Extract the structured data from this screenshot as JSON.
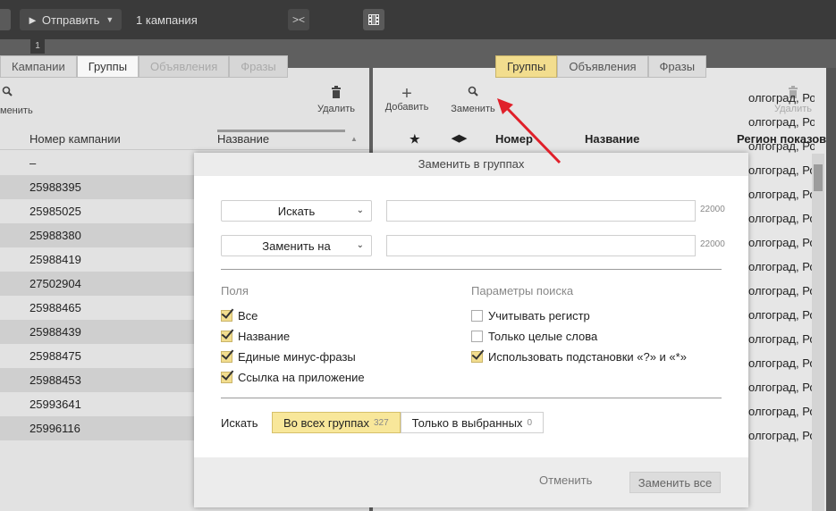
{
  "toolbar": {
    "send_label": "Отправить",
    "campaign_count": "1 кампания",
    "badge": "1",
    "collapse_glyph": "><"
  },
  "left": {
    "tabs": [
      {
        "label": "Кампании"
      },
      {
        "label": "Группы"
      },
      {
        "label": "Объявления"
      },
      {
        "label": "Фразы"
      }
    ],
    "replace_label": "менить",
    "delete_label": "Удалить",
    "columns": {
      "number": "Номер кампании",
      "name": "Название"
    },
    "rows": [
      "–",
      "25988395",
      "25985025",
      "25988380",
      "25988419",
      "27502904",
      "25988465",
      "25988439",
      "25988475",
      "25988453",
      "25993641",
      "25996116"
    ]
  },
  "right": {
    "tabs": [
      {
        "label": "Группы"
      },
      {
        "label": "Объявления"
      },
      {
        "label": "Фразы"
      }
    ],
    "add_label": "Добавить",
    "replace_label": "Заменить",
    "delete_label": "Удалить",
    "columns": {
      "star": "★",
      "number": "Номер",
      "name": "Название",
      "region": "Регион показов"
    },
    "region_rows": [
      "олгоград, Ро",
      "олгоград, Ро",
      "олгоград, Ро",
      "олгоград, Ро",
      "олгоград, Ро",
      "олгоград, Ро",
      "олгоград, Ро",
      "олгоград, Ро",
      "олгоград, Ро",
      "олгоград, Ро",
      "олгоград, Ро",
      "олгоград, Ро",
      "олгоград, Ро",
      "олгоград, Ро",
      "олгоград, Ро"
    ]
  },
  "modal": {
    "title": "Заменить в группах",
    "search_mode": "Искать",
    "replace_mode": "Заменить на",
    "search_value": "",
    "replace_value": "",
    "search_limit": "22000",
    "replace_limit": "22000",
    "fields_title": "Поля",
    "fields": [
      {
        "label": "Все",
        "checked": true
      },
      {
        "label": "Название",
        "checked": true
      },
      {
        "label": "Единые минус-фразы",
        "checked": true
      },
      {
        "label": "Ссылка на приложение",
        "checked": true
      }
    ],
    "params_title": "Параметры поиска",
    "params": [
      {
        "label": "Учитывать регистр",
        "checked": false
      },
      {
        "label": "Только целые слова",
        "checked": false
      },
      {
        "label": "Использовать подстановки «?» и «*»",
        "checked": true
      }
    ],
    "scope_label": "Искать",
    "scope_all": "Во всех группах",
    "scope_all_count": "327",
    "scope_selected": "Только в выбранных",
    "scope_selected_count": "0",
    "cancel_label": "Отменить",
    "replace_all_label": "Заменить все"
  },
  "colors": {
    "accent_yellow": "#f2dd8e",
    "arrow_red": "#e0202a"
  }
}
